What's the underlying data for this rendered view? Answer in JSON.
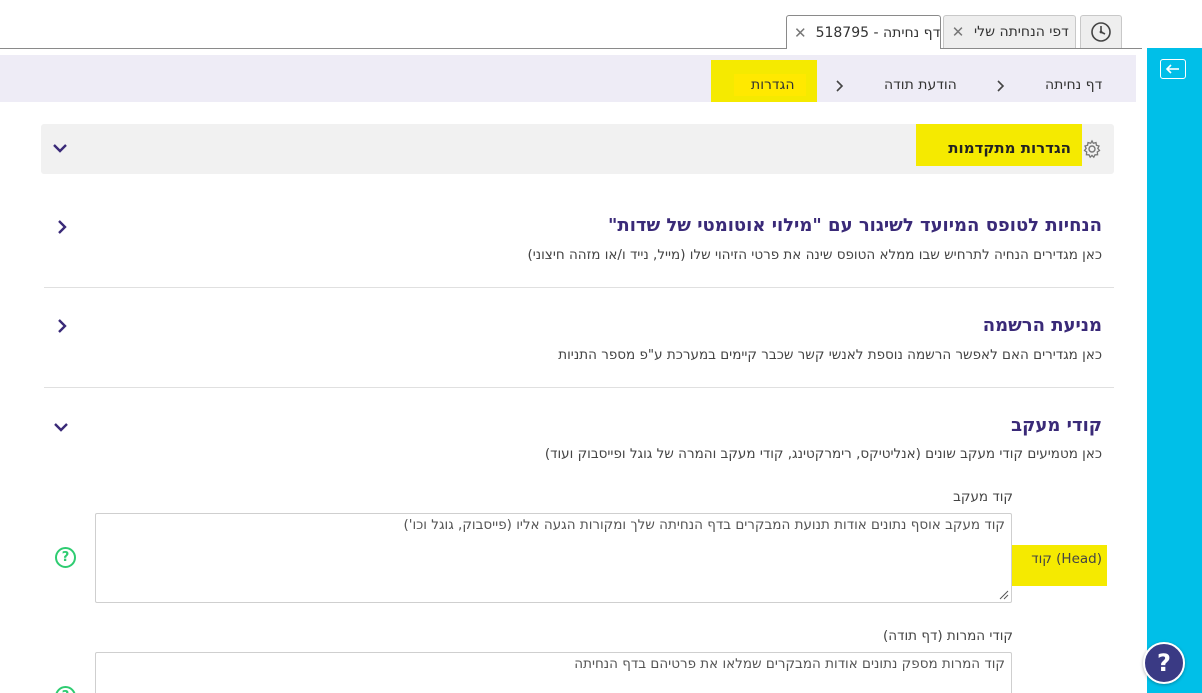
{
  "tabs": [
    {
      "label": "דפי הנחיתה שלי",
      "close": "✕"
    },
    {
      "label": "518795 - דף נחיתה",
      "close": "✕"
    }
  ],
  "breadcrumb": {
    "items": [
      "דף נחיתה",
      "הודעת תודה",
      "הגדרות"
    ]
  },
  "advanced_settings": {
    "title": "הגדרות מתקדמות"
  },
  "sections": [
    {
      "title": "הנחיות לטופס המיועד לשיגור עם \"מילוי אוטומטי של שדות\"",
      "description": "כאן מגדירים הנחיה לתרחיש שבו ממלא הטופס שינה את פרטי הזיהוי שלו (מייל, נייד ו/או מזהה חיצוני)"
    },
    {
      "title": "מניעת הרשמה",
      "description": "כאן מגדירים האם לאפשר הרשמה נוספת לאנשי קשר שכבר קיימים במערכת ע\"פ מספר התניות"
    },
    {
      "title": "קודי מעקב",
      "description": "כאן מטמיעים קודי מעקב שונים (אנליטיקס, רימרקטינג, קודי מעקב והמרה של גוגל ופייסבוק ועוד)"
    }
  ],
  "tracking": {
    "tracking_code_label": "קוד מעקב",
    "head_label": "קוד (Head)",
    "head_placeholder": "קוד מעקב אוסף נתונים אודות תנועת המבקרים בדף הנחיתה שלך ומקורות הגעה אליו (פייסבוק, גוגל וכו')",
    "conversion_label": "קודי המרות (דף תודה)",
    "conversion_placeholder": "קוד המרות מספק נתונים אודות המבקרים שמלאו את פרטיהם בדף הנחיתה"
  },
  "help_button": "?",
  "colors": {
    "sidebar": "#00bfe8",
    "highlight": "#f5ea00",
    "section_title": "#3a2a78",
    "help_icon": "#2ecc71"
  }
}
